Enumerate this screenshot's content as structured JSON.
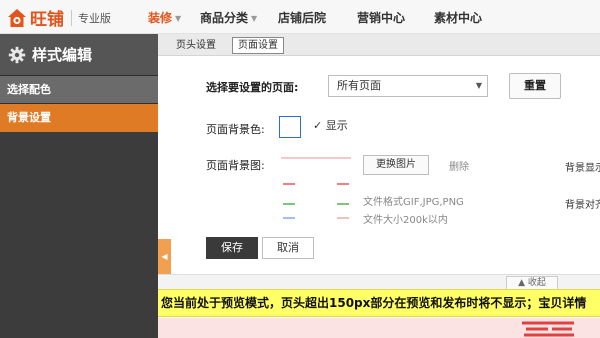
{
  "header": {
    "logo_text": "旺铺",
    "edition": "专业版",
    "brand_color": "#e2551c",
    "nav": [
      {
        "label": "装修",
        "active": true,
        "has_caret": true
      },
      {
        "label": "商品分类",
        "active": false,
        "has_caret": true
      },
      {
        "label": "店铺后院",
        "active": false,
        "has_caret": false
      },
      {
        "label": "营销中心",
        "active": false,
        "has_caret": false
      },
      {
        "label": "素材中心",
        "active": false,
        "has_caret": false
      }
    ],
    "caret_glyph": "▼"
  },
  "sidebar": {
    "title": "样式编辑",
    "title_icon": "gear-icon",
    "items": [
      {
        "label": "选择配色",
        "active": false
      },
      {
        "label": "背景设置",
        "active": true
      }
    ],
    "active_color": "#e07b25"
  },
  "subtabs": [
    {
      "label": "页头设置",
      "active": false
    },
    {
      "label": "页面设置",
      "active": true
    }
  ],
  "form": {
    "page_select_label": "选择要设置的页面:",
    "page_select_value": "所有页面",
    "reset_label": "重置",
    "bg_color_label": "页面背景色:",
    "bg_color_value": "#ffffff",
    "show_label": "显示",
    "show_checked": true,
    "bg_image_label": "页面背景图:",
    "change_image_label": "更换图片",
    "delete_label": "删除",
    "hint_format": "文件格式GIF,JPG,PNG",
    "hint_size": "文件大小200k以内",
    "bg_display_label": "背景显示",
    "bg_align_label": "背景对齐",
    "save_label": "保存",
    "cancel_label": "取消"
  },
  "preview": {
    "collapse_label": "▲ 收起",
    "notice": "您当前处于预览模式，页头超出150px部分在预览和发布时将不显示；宝贝详情"
  }
}
